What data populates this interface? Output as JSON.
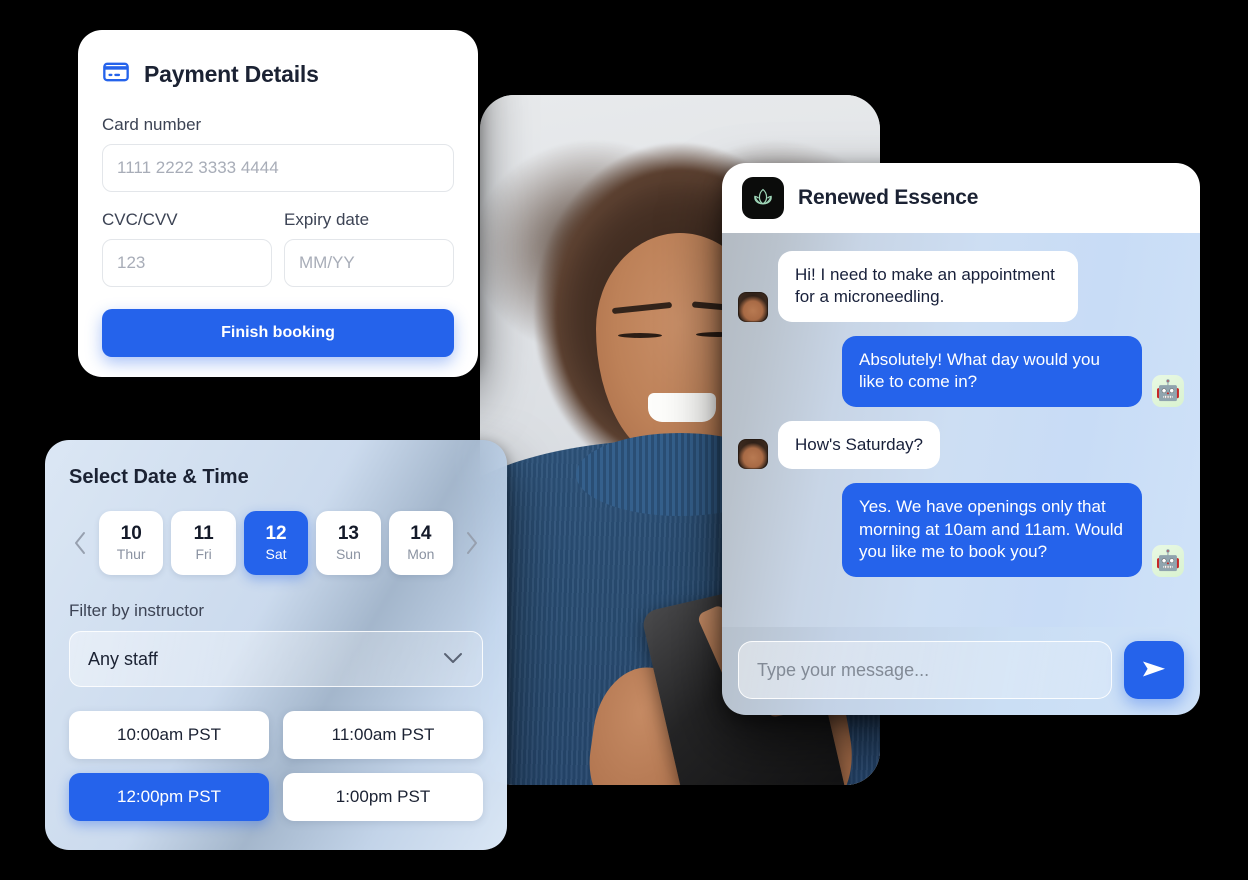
{
  "payment": {
    "icon": "credit-card-icon",
    "title": "Payment Details",
    "card_number_label": "Card number",
    "card_number_placeholder": "1111 2222 3333 4444",
    "cvc_label": "CVC/CVV",
    "cvc_placeholder": "123",
    "expiry_label": "Expiry date",
    "expiry_placeholder": "MM/YY",
    "submit_label": "Finish booking"
  },
  "datetime": {
    "title": "Select Date & Time",
    "prev_icon": "chevron-left-icon",
    "next_icon": "chevron-right-icon",
    "dates": [
      {
        "day": "10",
        "weekday": "Thur",
        "selected": false
      },
      {
        "day": "11",
        "weekday": "Fri",
        "selected": false
      },
      {
        "day": "12",
        "weekday": "Sat",
        "selected": true
      },
      {
        "day": "13",
        "weekday": "Sun",
        "selected": false
      },
      {
        "day": "14",
        "weekday": "Mon",
        "selected": false
      }
    ],
    "filter_label": "Filter by instructor",
    "filter_value": "Any staff",
    "filter_icon": "chevron-down-icon",
    "slots": [
      {
        "label": "10:00am PST",
        "selected": false
      },
      {
        "label": "11:00am PST",
        "selected": false
      },
      {
        "label": "12:00pm PST",
        "selected": true
      },
      {
        "label": "1:00pm PST",
        "selected": false
      }
    ]
  },
  "chat": {
    "logo_icon": "lotus-logo-icon",
    "business_name": "Renewed Essence",
    "messages": [
      {
        "from": "user",
        "text": "Hi! I need to make an appointment for a microneedling.",
        "avatar": "user-avatar"
      },
      {
        "from": "bot",
        "text": "Absolutely! What day would you like to come in?",
        "avatar": "robot-avatar"
      },
      {
        "from": "user",
        "text": "How's Saturday?",
        "avatar": "user-avatar"
      },
      {
        "from": "bot",
        "text": "Yes. We have openings only that morning at 10am and 11am. Would you like me to book you?",
        "avatar": "robot-avatar"
      }
    ],
    "input_placeholder": "Type your message...",
    "send_icon": "send-icon"
  },
  "photo": {
    "alt": "smiling-woman-using-phone"
  },
  "colors": {
    "accent": "#2563EB",
    "text_dark": "#1B2233",
    "placeholder": "#A8ADB8",
    "logo_green": "#9FD6B8",
    "background": "#000000"
  }
}
